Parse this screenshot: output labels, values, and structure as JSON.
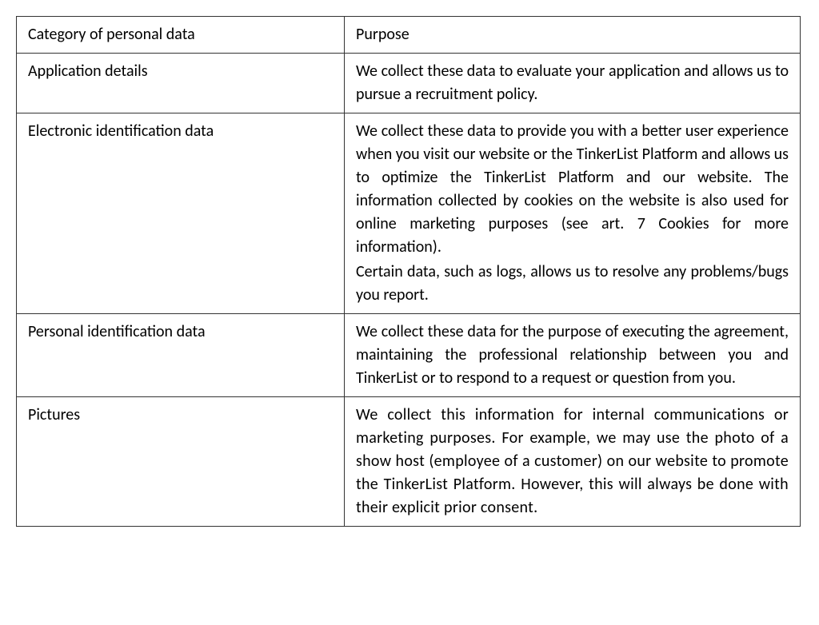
{
  "table": {
    "header": {
      "col_left": "Category of personal data",
      "col_right": "Purpose"
    },
    "rows": [
      {
        "category": "Application details",
        "purpose": "We collect these data to evaluate your application and allows us to pursue a recruitment policy."
      },
      {
        "category": "Electronic identification data",
        "purpose_p1": "We collect these data to provide you with a better user experience when you visit our website or the TinkerList Platform and allows us to optimize the TinkerList Platform and our website. The information collected by cookies on the website is also used for online marketing purposes (see art. 7 Cookies for more information).",
        "purpose_p2": "Certain data, such as logs, allows us to resolve any problems/bugs you report."
      },
      {
        "category": "Personal identification data",
        "purpose": "We collect these data for the purpose of executing the agreement, maintaining the professional relationship between you and TinkerList or to respond to a request or question from you."
      },
      {
        "category": "Pictures",
        "purpose": "We collect this information for internal communications or marketing purposes. For example, we may use the photo of a show host (employee of a customer) on our website to promote the TinkerList Platform. However, this will always be done with their explicit prior consent."
      }
    ]
  }
}
